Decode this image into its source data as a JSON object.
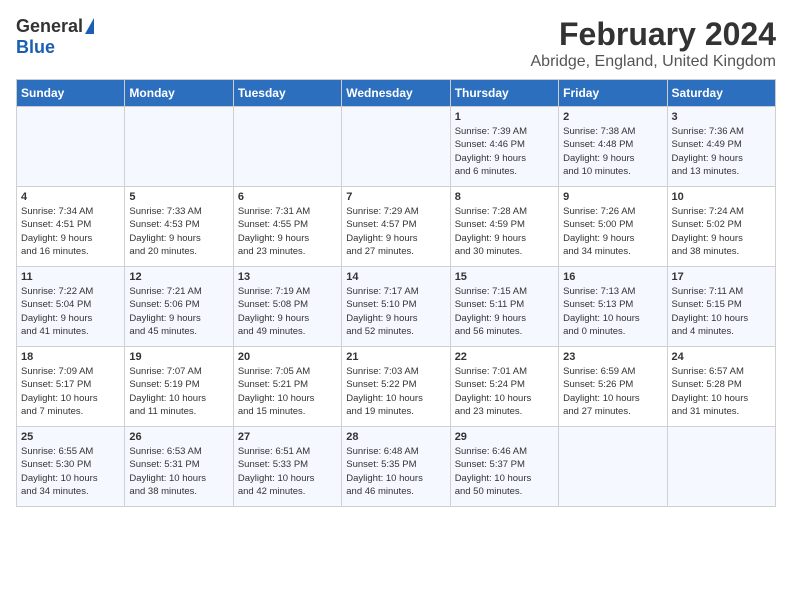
{
  "app": {
    "name_general": "General",
    "name_blue": "Blue"
  },
  "header": {
    "title": "February 2024",
    "subtitle": "Abridge, England, United Kingdom"
  },
  "calendar": {
    "days_of_week": [
      "Sunday",
      "Monday",
      "Tuesday",
      "Wednesday",
      "Thursday",
      "Friday",
      "Saturday"
    ],
    "weeks": [
      [
        {
          "day": "",
          "info": ""
        },
        {
          "day": "",
          "info": ""
        },
        {
          "day": "",
          "info": ""
        },
        {
          "day": "",
          "info": ""
        },
        {
          "day": "1",
          "info": "Sunrise: 7:39 AM\nSunset: 4:46 PM\nDaylight: 9 hours\nand 6 minutes."
        },
        {
          "day": "2",
          "info": "Sunrise: 7:38 AM\nSunset: 4:48 PM\nDaylight: 9 hours\nand 10 minutes."
        },
        {
          "day": "3",
          "info": "Sunrise: 7:36 AM\nSunset: 4:49 PM\nDaylight: 9 hours\nand 13 minutes."
        }
      ],
      [
        {
          "day": "4",
          "info": "Sunrise: 7:34 AM\nSunset: 4:51 PM\nDaylight: 9 hours\nand 16 minutes."
        },
        {
          "day": "5",
          "info": "Sunrise: 7:33 AM\nSunset: 4:53 PM\nDaylight: 9 hours\nand 20 minutes."
        },
        {
          "day": "6",
          "info": "Sunrise: 7:31 AM\nSunset: 4:55 PM\nDaylight: 9 hours\nand 23 minutes."
        },
        {
          "day": "7",
          "info": "Sunrise: 7:29 AM\nSunset: 4:57 PM\nDaylight: 9 hours\nand 27 minutes."
        },
        {
          "day": "8",
          "info": "Sunrise: 7:28 AM\nSunset: 4:59 PM\nDaylight: 9 hours\nand 30 minutes."
        },
        {
          "day": "9",
          "info": "Sunrise: 7:26 AM\nSunset: 5:00 PM\nDaylight: 9 hours\nand 34 minutes."
        },
        {
          "day": "10",
          "info": "Sunrise: 7:24 AM\nSunset: 5:02 PM\nDaylight: 9 hours\nand 38 minutes."
        }
      ],
      [
        {
          "day": "11",
          "info": "Sunrise: 7:22 AM\nSunset: 5:04 PM\nDaylight: 9 hours\nand 41 minutes."
        },
        {
          "day": "12",
          "info": "Sunrise: 7:21 AM\nSunset: 5:06 PM\nDaylight: 9 hours\nand 45 minutes."
        },
        {
          "day": "13",
          "info": "Sunrise: 7:19 AM\nSunset: 5:08 PM\nDaylight: 9 hours\nand 49 minutes."
        },
        {
          "day": "14",
          "info": "Sunrise: 7:17 AM\nSunset: 5:10 PM\nDaylight: 9 hours\nand 52 minutes."
        },
        {
          "day": "15",
          "info": "Sunrise: 7:15 AM\nSunset: 5:11 PM\nDaylight: 9 hours\nand 56 minutes."
        },
        {
          "day": "16",
          "info": "Sunrise: 7:13 AM\nSunset: 5:13 PM\nDaylight: 10 hours\nand 0 minutes."
        },
        {
          "day": "17",
          "info": "Sunrise: 7:11 AM\nSunset: 5:15 PM\nDaylight: 10 hours\nand 4 minutes."
        }
      ],
      [
        {
          "day": "18",
          "info": "Sunrise: 7:09 AM\nSunset: 5:17 PM\nDaylight: 10 hours\nand 7 minutes."
        },
        {
          "day": "19",
          "info": "Sunrise: 7:07 AM\nSunset: 5:19 PM\nDaylight: 10 hours\nand 11 minutes."
        },
        {
          "day": "20",
          "info": "Sunrise: 7:05 AM\nSunset: 5:21 PM\nDaylight: 10 hours\nand 15 minutes."
        },
        {
          "day": "21",
          "info": "Sunrise: 7:03 AM\nSunset: 5:22 PM\nDaylight: 10 hours\nand 19 minutes."
        },
        {
          "day": "22",
          "info": "Sunrise: 7:01 AM\nSunset: 5:24 PM\nDaylight: 10 hours\nand 23 minutes."
        },
        {
          "day": "23",
          "info": "Sunrise: 6:59 AM\nSunset: 5:26 PM\nDaylight: 10 hours\nand 27 minutes."
        },
        {
          "day": "24",
          "info": "Sunrise: 6:57 AM\nSunset: 5:28 PM\nDaylight: 10 hours\nand 31 minutes."
        }
      ],
      [
        {
          "day": "25",
          "info": "Sunrise: 6:55 AM\nSunset: 5:30 PM\nDaylight: 10 hours\nand 34 minutes."
        },
        {
          "day": "26",
          "info": "Sunrise: 6:53 AM\nSunset: 5:31 PM\nDaylight: 10 hours\nand 38 minutes."
        },
        {
          "day": "27",
          "info": "Sunrise: 6:51 AM\nSunset: 5:33 PM\nDaylight: 10 hours\nand 42 minutes."
        },
        {
          "day": "28",
          "info": "Sunrise: 6:48 AM\nSunset: 5:35 PM\nDaylight: 10 hours\nand 46 minutes."
        },
        {
          "day": "29",
          "info": "Sunrise: 6:46 AM\nSunset: 5:37 PM\nDaylight: 10 hours\nand 50 minutes."
        },
        {
          "day": "",
          "info": ""
        },
        {
          "day": "",
          "info": ""
        }
      ]
    ]
  }
}
